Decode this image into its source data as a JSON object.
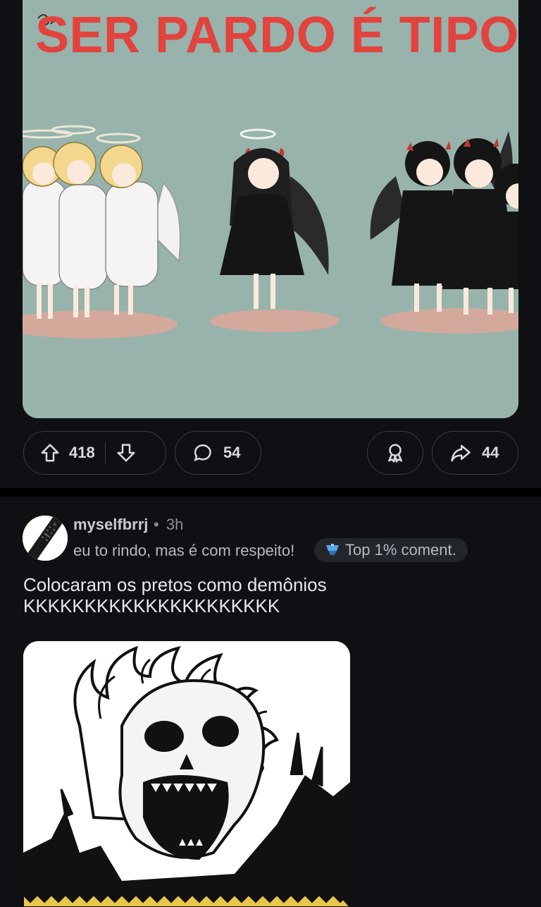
{
  "post": {
    "meme_title": "SER PARDO É TIPO",
    "upvotes": "418",
    "comments": "54",
    "shares": "44"
  },
  "comment": {
    "username": "myselfbrrj",
    "separator": "•",
    "time": "3h",
    "flair": "eu to rindo, mas é com respeito!",
    "badge_label": "Top 1% coment.",
    "body_line1": "Colocaram os pretos como demônios",
    "body_line2": "KKKKKKKKKKKKKKKKKKKKK"
  },
  "icons": {
    "upvote": "arrow-up-icon",
    "downvote": "arrow-down-icon",
    "comment": "speech-bubble-icon",
    "award": "award-icon",
    "share": "share-arrow-icon",
    "badge": "trophy-badge-icon"
  },
  "colors": {
    "background": "#0e1013",
    "meme_background": "#97b3ac",
    "meme_title": "#e2433c",
    "badge_background": "#22262b"
  }
}
